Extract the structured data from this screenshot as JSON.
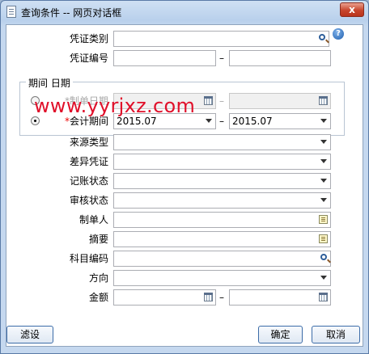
{
  "window": {
    "title": "查询条件 -- 网页对话框",
    "close_label": "x"
  },
  "help_label": "?",
  "fields": {
    "voucher_type_label": "凭证类别",
    "voucher_no_label": "凭证编号",
    "range_separator": "–",
    "period_group_label": "期间 日期",
    "create_date_label": "制单日期",
    "accounting_period_label": "会计期间",
    "accounting_period_from": "2015.07",
    "accounting_period_to": "2015.07",
    "required_mark": "*",
    "source_type_label": "来源类型",
    "diff_voucher_label": "差异凭证",
    "posting_status_label": "记账状态",
    "audit_status_label": "审核状态",
    "creator_label": "制单人",
    "summary_label": "摘要",
    "account_code_label": "科目编码",
    "direction_label": "方向",
    "amount_label": "金额"
  },
  "watermark": "www.yyrjxz.com",
  "buttons": {
    "filter": "滤设",
    "ok": "确定",
    "cancel": "取消"
  }
}
